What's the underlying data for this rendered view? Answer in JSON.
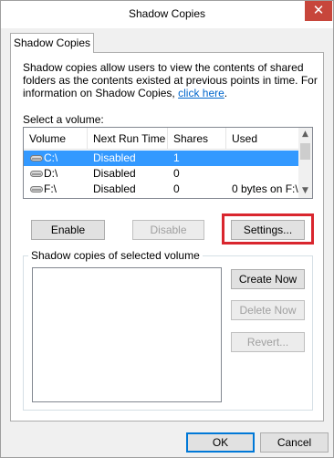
{
  "window": {
    "title": "Shadow Copies",
    "close_glyph": "✕"
  },
  "tab": {
    "label": "Shadow Copies"
  },
  "description": {
    "text": "Shadow copies allow users to view the contents of shared folders as the contents existed at previous points in time. For information on Shadow Copies, ",
    "link": "click here",
    "end": "."
  },
  "select_volume_label": "Select a volume:",
  "volume_list": {
    "columns": [
      "Volume",
      "Next Run Time",
      "Shares",
      "Used"
    ],
    "rows": [
      {
        "volume": "C:\\",
        "next_run": "Disabled",
        "shares": "1",
        "used": "",
        "selected": true
      },
      {
        "volume": "D:\\",
        "next_run": "Disabled",
        "shares": "0",
        "used": ""
      },
      {
        "volume": "F:\\",
        "next_run": "Disabled",
        "shares": "0",
        "used": "0 bytes on F:\\"
      }
    ]
  },
  "buttons": {
    "enable": "Enable",
    "disable": "Disable",
    "settings": "Settings...",
    "create_now": "Create Now",
    "delete_now": "Delete Now",
    "revert": "Revert...",
    "ok": "OK",
    "cancel": "Cancel"
  },
  "group": {
    "title": "Shadow copies of selected volume"
  },
  "colors": {
    "selection": "#3399ff",
    "highlight_box": "#d9262e",
    "close": "#c7463b",
    "link": "#0066cc"
  },
  "icons": {
    "drive": "drive-icon",
    "scroll_up": "▲",
    "scroll_down": "▼"
  }
}
